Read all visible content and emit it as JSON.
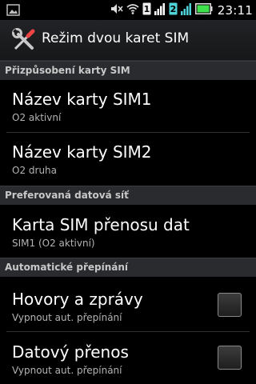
{
  "status_bar": {
    "time": "23:11",
    "icons": [
      "image-notification-icon",
      "muted-icon",
      "wifi-icon",
      "sim1-signal-icon",
      "sim2-signal-icon",
      "battery-icon"
    ],
    "sim1_label": "1",
    "sim2_label": "2"
  },
  "title_bar": {
    "title": "Režim dvou karet SIM",
    "icon": "tools-icon"
  },
  "sections": {
    "sim_custom": {
      "header": "Přizpůsobení karty SIM"
    },
    "preferred_net": {
      "header": "Preferovaná datová síť"
    },
    "auto_switch": {
      "header": "Automatické přepínání"
    }
  },
  "prefs": {
    "sim1_name": {
      "title": "Název karty SIM1",
      "summary": "O2 aktivní"
    },
    "sim2_name": {
      "title": "Název karty SIM2",
      "summary": "O2 druha"
    },
    "data_sim": {
      "title": "Karta SIM přenosu dat",
      "summary": "SIM1 (O2 aktivní)"
    },
    "calls_messages": {
      "title": "Hovory a zprávy",
      "summary": "Vypnout aut. přepínání",
      "checked": false
    },
    "data_transfer": {
      "title": "Datový přenos",
      "summary": "Vypnout aut. přepínání",
      "checked": false
    }
  },
  "colors": {
    "sim2_accent": "#4fd2d8",
    "battery": "#3ee14b",
    "signal": "#ffffff"
  }
}
